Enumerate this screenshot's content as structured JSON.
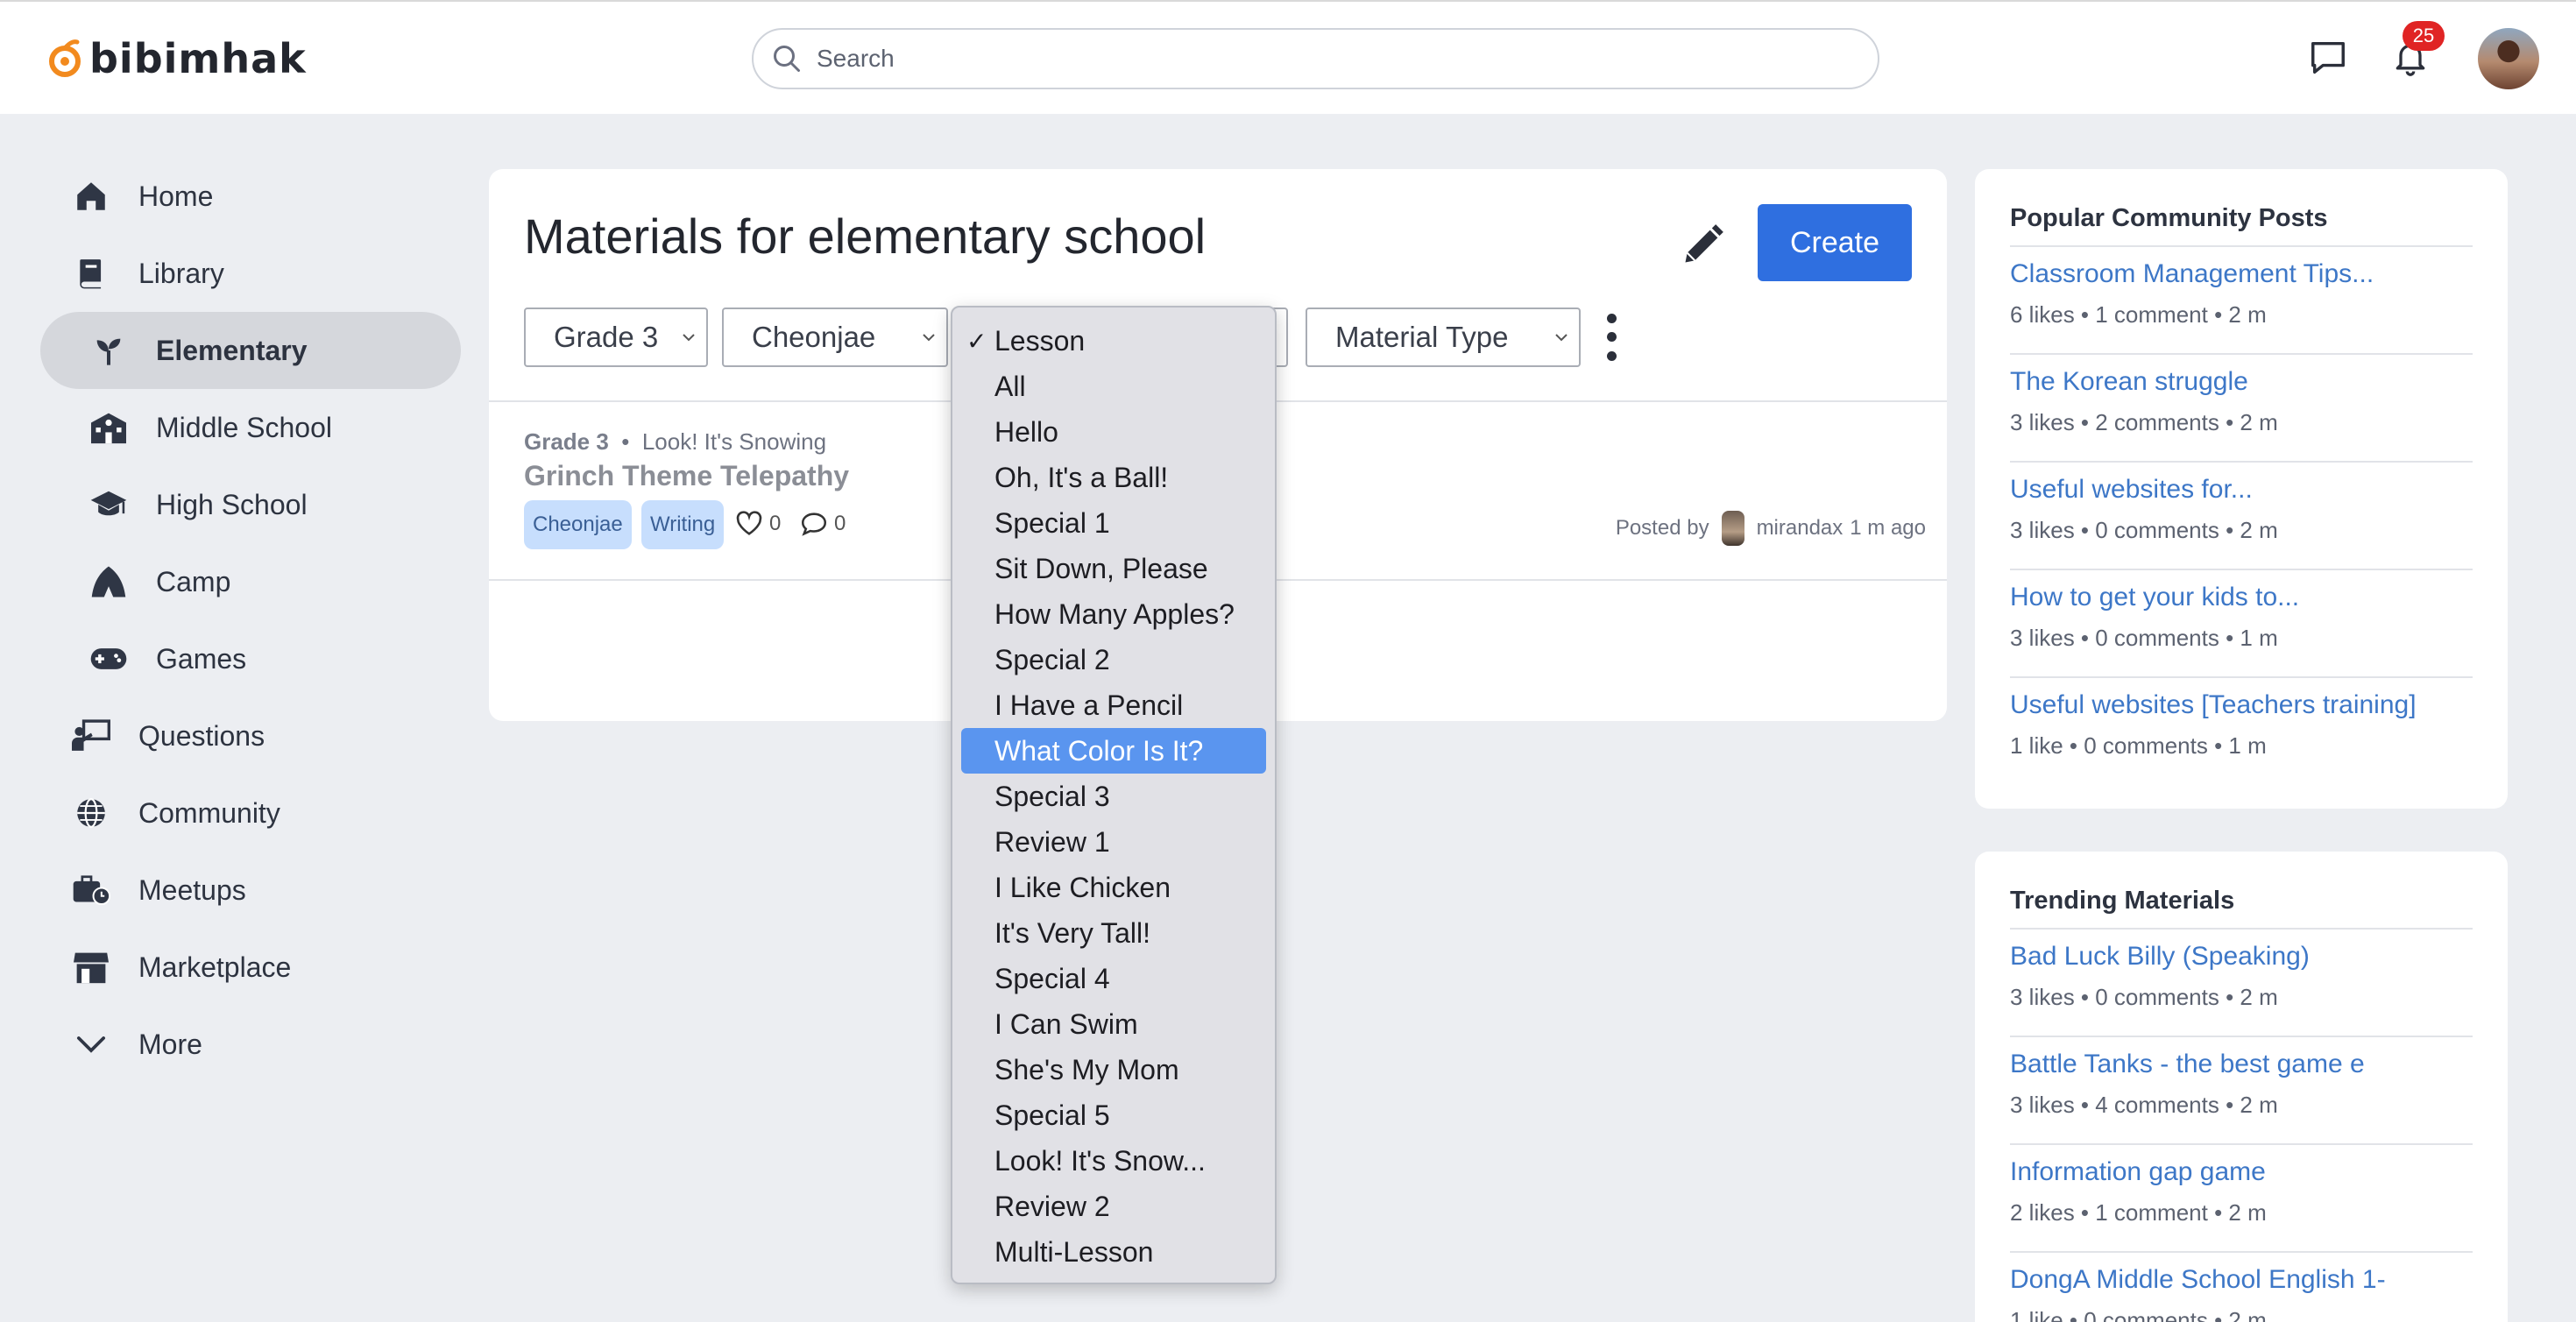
{
  "header": {
    "brand": "bibimhak",
    "search_placeholder": "Search",
    "notification_count": "25"
  },
  "sidebar": {
    "items": [
      {
        "label": "Home",
        "icon": "home-icon"
      },
      {
        "label": "Library",
        "icon": "book-icon"
      },
      {
        "label": "Elementary",
        "icon": "sprout-icon",
        "active": true
      },
      {
        "label": "Middle School",
        "icon": "school-building-icon"
      },
      {
        "label": "High School",
        "icon": "graduation-cap-icon"
      },
      {
        "label": "Camp",
        "icon": "tent-icon"
      },
      {
        "label": "Games",
        "icon": "gamepad-icon"
      },
      {
        "label": "Questions",
        "icon": "teacher-board-icon"
      },
      {
        "label": "Community",
        "icon": "globe-icon"
      },
      {
        "label": "Meetups",
        "icon": "briefcase-clock-icon"
      },
      {
        "label": "Marketplace",
        "icon": "storefront-icon"
      },
      {
        "label": "More",
        "icon": "chevron-down-icon"
      }
    ]
  },
  "main": {
    "title": "Materials for elementary school",
    "create_label": "Create",
    "filters": {
      "grade": "Grade 3",
      "publisher": "Cheonjae",
      "material_type": "Material Type"
    },
    "post": {
      "grade": "Grade 3",
      "lesson": "Look! It's Snowing",
      "title": "Grinch Theme Telepathy",
      "tags": [
        "Cheonjae",
        "Writing"
      ],
      "likes": "0",
      "comments": "0",
      "posted_by_label": "Posted by",
      "author": "mirandax",
      "time": "1 m ago"
    }
  },
  "dropdown": {
    "selected": "Lesson",
    "highlighted": "What Color Is It?",
    "options": [
      "Lesson",
      "All",
      "Hello",
      "Oh, It's a Ball!",
      "Special 1",
      "Sit Down, Please",
      "How Many Apples?",
      "Special 2",
      "I Have a Pencil",
      "What Color Is It?",
      "Special 3",
      "Review 1",
      "I Like Chicken",
      "It's Very Tall!",
      "Special 4",
      "I Can Swim",
      "She's My Mom",
      "Special 5",
      "Look! It's Snow...",
      "Review 2",
      "Multi-Lesson"
    ]
  },
  "popular": {
    "title": "Popular Community Posts",
    "items": [
      {
        "title": "Classroom Management Tips...",
        "stats": "6 likes • 1 comment • 2 m"
      },
      {
        "title": "The Korean struggle",
        "stats": "3 likes • 2 comments • 2 m"
      },
      {
        "title": "Useful websites for...",
        "stats": "3 likes • 0 comments • 2 m"
      },
      {
        "title": "How to get your kids to...",
        "stats": "3 likes • 0 comments • 1 m"
      },
      {
        "title": "Useful websites [Teachers training]",
        "stats": "1 like • 0 comments • 1 m"
      }
    ]
  },
  "trending": {
    "title": "Trending Materials",
    "items": [
      {
        "title": "Bad Luck Billy (Speaking)",
        "stats": "3 likes • 0 comments • 2 m"
      },
      {
        "title": "Battle Tanks - the best game e",
        "stats": "3 likes • 4 comments • 2 m"
      },
      {
        "title": "Information gap game",
        "stats": "2 likes • 1 comment • 2 m"
      },
      {
        "title": "DongA Middle School English 1-",
        "stats": "1 like • 0 comments • 2 m"
      }
    ]
  },
  "colors": {
    "accent": "#2f6fe0",
    "link": "#3d77c7",
    "highlight": "#5a95ef",
    "badge": "#e02424",
    "brand_orange": "#f28a1e"
  }
}
